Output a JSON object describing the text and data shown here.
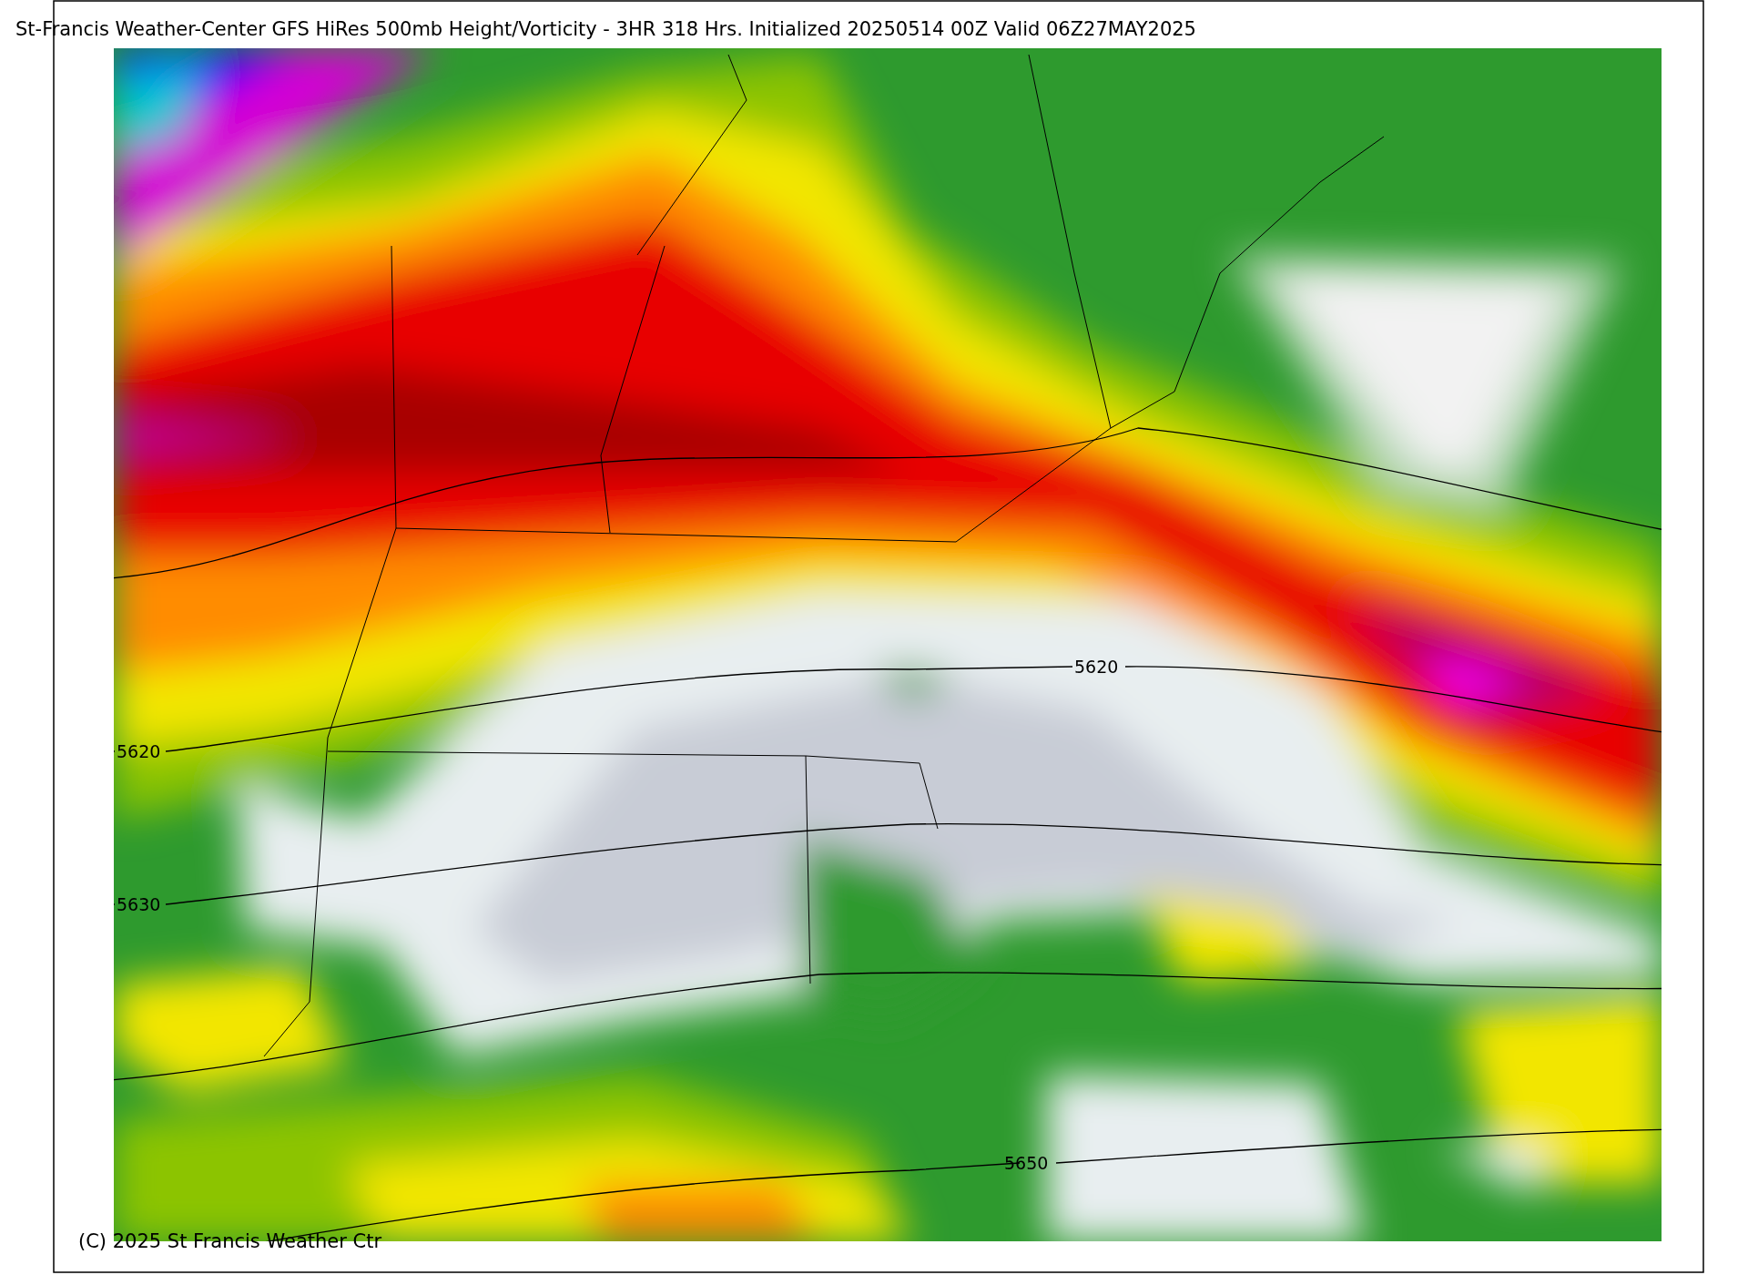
{
  "title": "St-Francis Weather-Center GFS HiRes 500mb Height/Vorticity - 3HR  318 Hrs.  Initialized 20250514 00Z Valid 06Z27MAY2025",
  "contour_labels": [
    {
      "text": "5620"
    },
    {
      "text": "5630"
    },
    {
      "text": "5620"
    },
    {
      "text": "5650"
    }
  ],
  "copyright": "(C) 2025 St Francis Weather Ctr"
}
